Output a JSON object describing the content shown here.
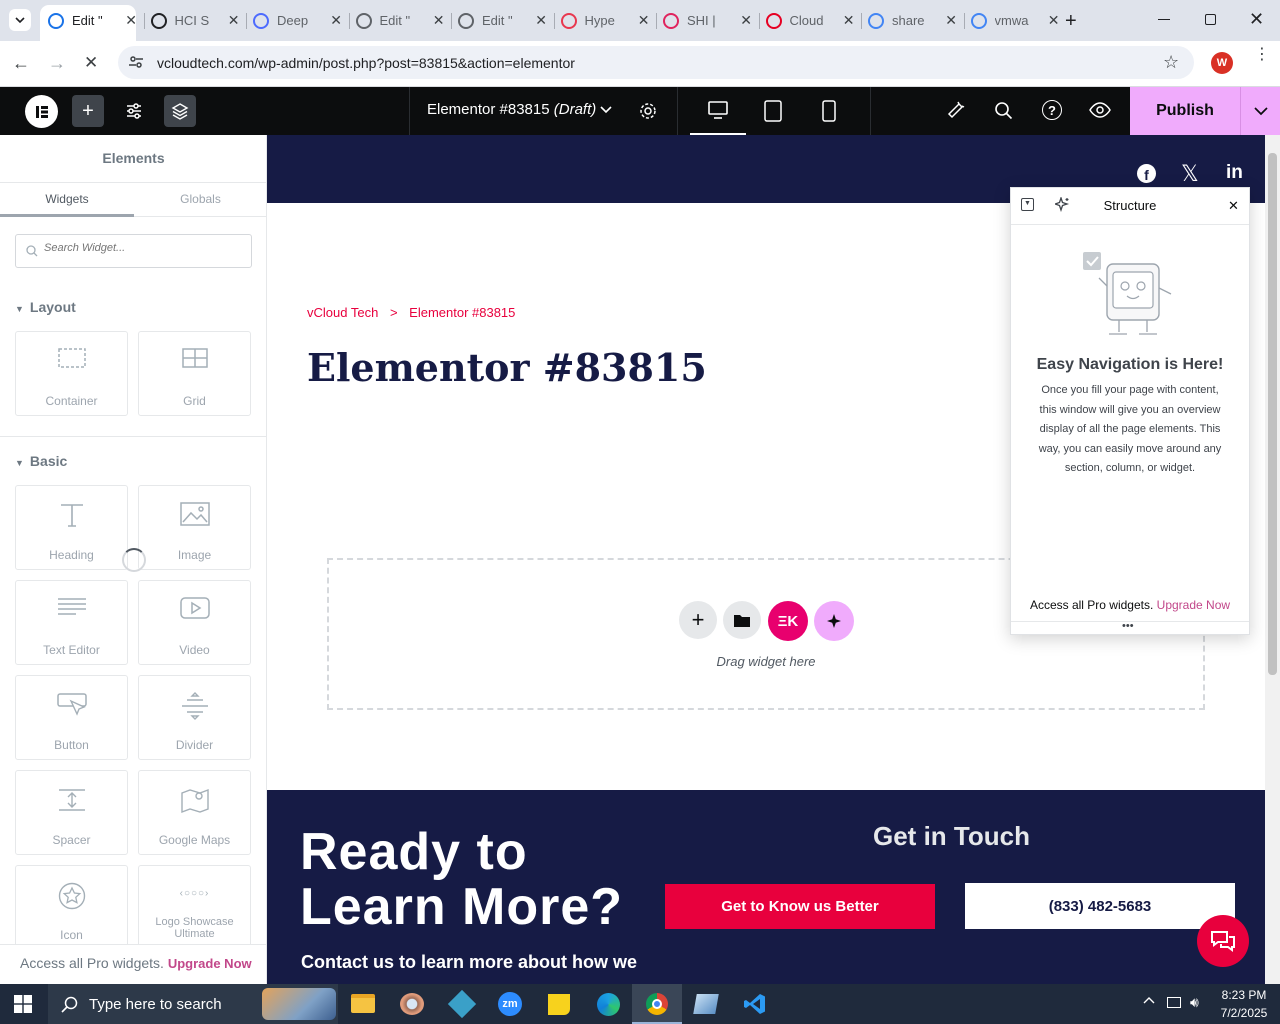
{
  "browser": {
    "tabs": [
      {
        "title": "Edit \"",
        "active": true,
        "color": "#1a73e8"
      },
      {
        "title": "HCI S",
        "active": false,
        "color": "#202124"
      },
      {
        "title": "Deep",
        "active": false,
        "color": "#4d6bfe"
      },
      {
        "title": "Edit \"",
        "active": false,
        "color": "#5f6368"
      },
      {
        "title": "Edit \"",
        "active": false,
        "color": "#5f6368"
      },
      {
        "title": "Hype",
        "active": false,
        "color": "#e8384f"
      },
      {
        "title": "SHI |",
        "active": false,
        "color": "#e0245e"
      },
      {
        "title": "Cloud",
        "active": false,
        "color": "#e60023"
      },
      {
        "title": "share",
        "active": false,
        "color": "#4285f4"
      },
      {
        "title": "vmwa",
        "active": false,
        "color": "#4285f4"
      }
    ],
    "url": "vcloudtech.com/wp-admin/post.php?post=83815&action=elementor",
    "profile_initial": "W"
  },
  "editor": {
    "doc_title": "Elementor #83815",
    "doc_status": "(Draft)",
    "publish_label": "Publish",
    "accent": "#f0abfc"
  },
  "panel": {
    "title": "Elements",
    "tabs": [
      "Widgets",
      "Globals"
    ],
    "search_placeholder": "Search Widget...",
    "sections": {
      "layout": "Layout",
      "basic": "Basic"
    },
    "layout_widgets": [
      "Container",
      "Grid"
    ],
    "basic_widgets": [
      "Heading",
      "Image",
      "Text Editor",
      "Video",
      "Button",
      "Divider",
      "Spacer",
      "Google Maps",
      "Icon",
      "Logo Showcase Ultimate"
    ],
    "footer_text": "Access all Pro widgets.",
    "footer_link": "Upgrade Now"
  },
  "page": {
    "breadcrumb_home": "vCloud Tech",
    "breadcrumb_sep": ">",
    "breadcrumb_current": "Elementor #83815",
    "heading": "Elementor #83815",
    "drop_hint": "Drag widget here",
    "cta_heading_line1": "Ready to",
    "cta_heading_line2": "Learn More?",
    "cta_text": "Contact us to learn more about how we",
    "get_in_touch": "Get in Touch",
    "btn_primary": "Get to Know us Better",
    "btn_phone": "(833) 482-5683",
    "navy": "#161b45",
    "red": "#e8003d"
  },
  "structure": {
    "title": "Structure",
    "heading": "Easy Navigation is Here!",
    "body": "Once you fill your page with content, this window will give you an overview display of all the page elements. This way, you can easily move around any section, column, or widget.",
    "footer_text": "Access all Pro widgets.",
    "footer_link": "Upgrade Now"
  },
  "taskbar": {
    "search_placeholder": "Type here to search",
    "time": "8:23 PM",
    "date": "7/2/2025"
  }
}
